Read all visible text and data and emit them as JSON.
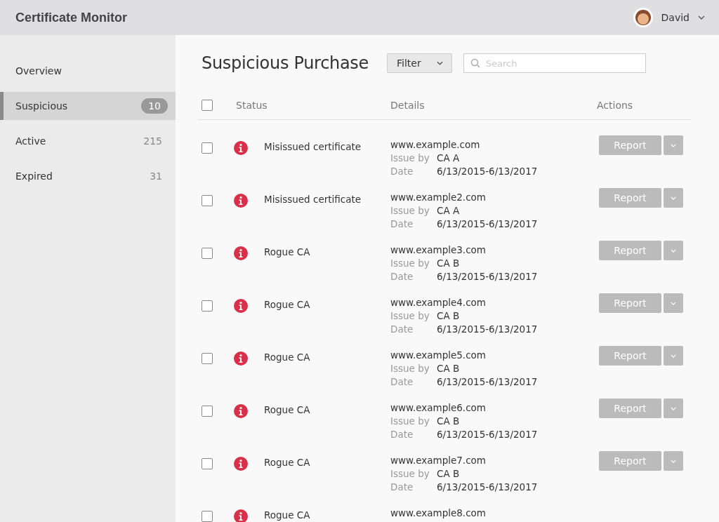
{
  "app_title": "Certificate Monitor",
  "user": {
    "name": "David"
  },
  "sidebar": {
    "items": [
      {
        "label": "Overview",
        "selected": false
      },
      {
        "label": "Suspicious",
        "count": "10",
        "selected": true
      },
      {
        "label": "Active",
        "count": "215",
        "selected": false
      },
      {
        "label": "Expired",
        "count": "31",
        "selected": false
      }
    ]
  },
  "page_title": "Suspicious Purchase",
  "filter": {
    "label": "Filter"
  },
  "search": {
    "placeholder": "Search"
  },
  "table": {
    "columns": [
      "Status",
      "Details",
      "Actions"
    ],
    "header_checked": false,
    "rows": [
      {
        "checked": false,
        "status": "Misissued certificate",
        "domain": "www.example.com",
        "issuer_label": "Issue by",
        "issuer": "CA A",
        "date_label": "Date",
        "date": "6/13/2015-6/13/2017",
        "action": "Report"
      },
      {
        "checked": false,
        "status": "Misissued certificate",
        "domain": "www.example2.com",
        "issuer_label": "Issue by",
        "issuer": "CA A",
        "date_label": "Date",
        "date": "6/13/2015-6/13/2017",
        "action": "Report"
      },
      {
        "checked": false,
        "status": "Rogue CA",
        "domain": "www.example3.com",
        "issuer_label": "Issue by",
        "issuer": "CA B",
        "date_label": "Date",
        "date": "6/13/2015-6/13/2017",
        "action": "Report"
      },
      {
        "checked": false,
        "status": "Rogue CA",
        "domain": "www.example4.com",
        "issuer_label": "Issue by",
        "issuer": "CA B",
        "date_label": "Date",
        "date": "6/13/2015-6/13/2017",
        "action": "Report"
      },
      {
        "checked": false,
        "status": "Rogue CA",
        "domain": "www.example5.com",
        "issuer_label": "Issue by",
        "issuer": "CA B",
        "date_label": "Date",
        "date": "6/13/2015-6/13/2017",
        "action": "Report"
      },
      {
        "checked": false,
        "status": "Rogue CA",
        "domain": "www.example6.com",
        "issuer_label": "Issue by",
        "issuer": "CA B",
        "date_label": "Date",
        "date": "6/13/2015-6/13/2017",
        "action": "Report"
      },
      {
        "checked": false,
        "status": "Rogue CA",
        "domain": "www.example7.com",
        "issuer_label": "Issue by",
        "issuer": "CA B",
        "date_label": "Date",
        "date": "6/13/2015-6/13/2017",
        "action": "Report"
      },
      {
        "checked": false,
        "status": "Rogue CA",
        "domain": "www.example8.com"
      }
    ]
  }
}
